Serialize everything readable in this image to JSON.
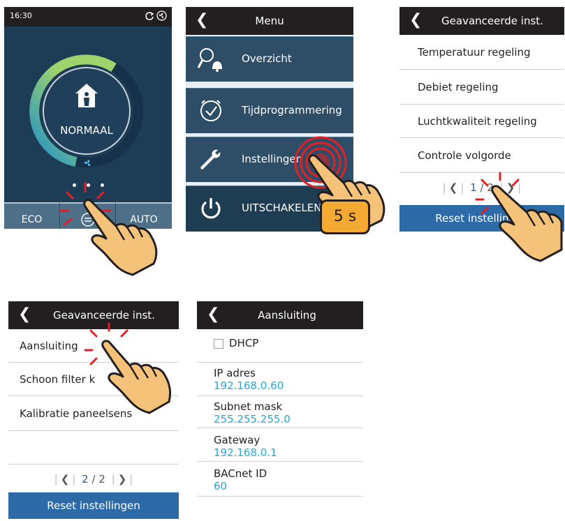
{
  "screen1": {
    "time": "16:30",
    "status_icons": [
      "refresh-icon",
      "fan-icon"
    ],
    "mode_label": "NORMAAL",
    "buttons": {
      "eco": "ECO",
      "auto": "AUTO"
    },
    "colors": {
      "bg": "#1d3c55",
      "arc_start": "#9fd46c",
      "arc_end": "#1e8fc8"
    }
  },
  "screen2": {
    "header_title": "Menu",
    "items": [
      {
        "label": "Overzicht",
        "icon": "search-bell-icon"
      },
      {
        "label": "Tijdprogrammering",
        "icon": "clock-icon"
      },
      {
        "label": "Instellingen",
        "icon": "wrench-icon"
      },
      {
        "label": "UITSCHAKELEN",
        "icon": "power-icon"
      }
    ],
    "hold_label": "5 s"
  },
  "screen3": {
    "header_title": "Geavanceerde inst.",
    "items": [
      "Temperatuur regeling",
      "Debiet regeling",
      "Luchtkwaliteit regeling",
      "Controle volgorde"
    ],
    "pager": {
      "current": "1",
      "total": "2"
    },
    "reset_label": "Reset instellingen"
  },
  "screen4": {
    "header_title": "Geavanceerde inst.",
    "items": [
      "Aansluiting",
      "Schoon filter k",
      "Kalibratie paneelsens"
    ],
    "pager": {
      "current": "2",
      "total": "2"
    },
    "reset_label": "Reset instellingen"
  },
  "screen5": {
    "header_title": "Aansluiting",
    "dhcp_label": "DHCP",
    "fields": [
      {
        "label": "IP adres",
        "value": "192.168.0.60"
      },
      {
        "label": "Subnet mask",
        "value": "255.255.255.0"
      },
      {
        "label": "Gateway",
        "value": "192.168.0.1"
      },
      {
        "label": "BACnet ID",
        "value": "60"
      }
    ]
  }
}
